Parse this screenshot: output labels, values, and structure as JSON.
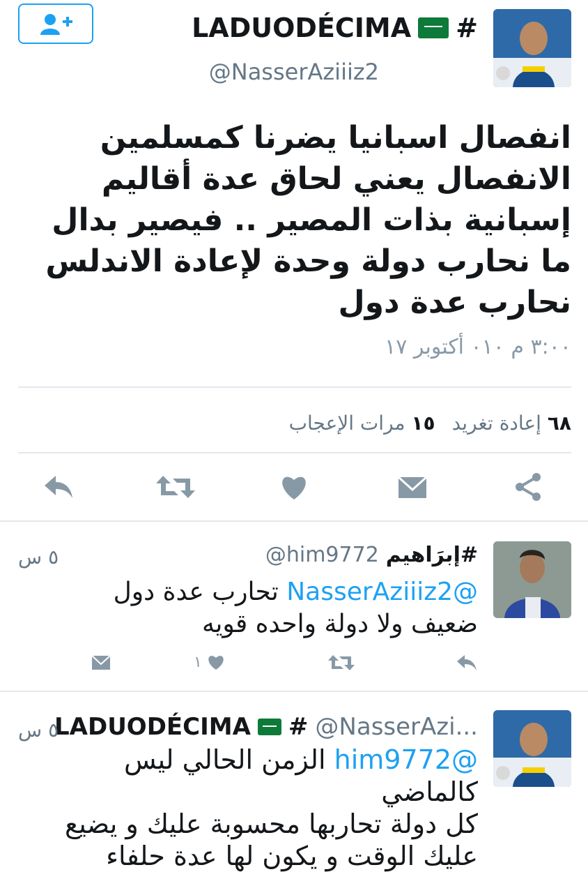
{
  "header": {
    "display_name": "LADUODÉCIMA",
    "hashtag_prefix": "#",
    "handle": "@NasserAziiiz2",
    "follow_icon": "add-user-icon"
  },
  "tweet": {
    "lines": [
      "انفصال اسبانيا يضرنا كمسلمين",
      "الانفصال يعني لحاق عدة أقاليم",
      "إسبانية بذات المصير .. فيصير بدال",
      "ما نحارب دولة وحدة لإعادة الاندلس",
      "نحارب عدة دول"
    ],
    "timestamp": "٣:٠٠ م ٠١٠ أكتوبر ١٧"
  },
  "stats": {
    "retweets_count": "٦٨",
    "retweets_label": "إعادة تغريد",
    "likes_count": "١٥",
    "likes_label": "مرات الإعجاب"
  },
  "actions": [
    "reply-icon",
    "retweet-icon",
    "like-icon",
    "message-icon",
    "share-icon"
  ],
  "replies": [
    {
      "name": "إبرَاهيم#",
      "handle": "@him9772",
      "time": "٥ س",
      "mention": "@NasserAziiiz2",
      "text_after_mention": "تحارب عدة دول",
      "line2": "ضعيف ولا دولة واحده قويه",
      "likes": "١"
    },
    {
      "name": "LADUODÉCIMA",
      "hashtag_prefix": "#",
      "handle": "@NasserAzi...",
      "time": "٥ س",
      "mention": "@him9772",
      "text_after_mention": "الزمن الحالي ليس كالماضي",
      "line2": "كل دولة تحاربها محسوبة عليك و يضيع",
      "line3": "عليك الوقت و يكون لها عدة حلفاء"
    }
  ],
  "colors": {
    "accent": "#1da1f2",
    "muted": "#657786",
    "icon": "#8899a6",
    "flag": "#0d7a3a"
  }
}
